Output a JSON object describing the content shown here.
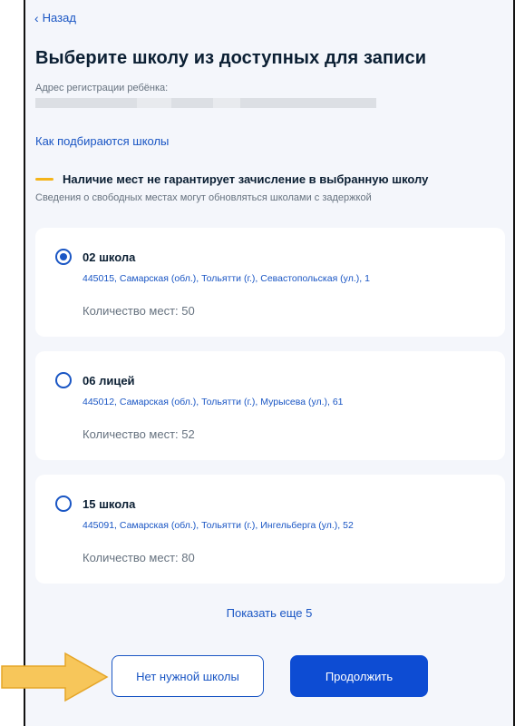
{
  "nav": {
    "back_label": "Назад"
  },
  "page": {
    "title": "Выберите школу из доступных для записи",
    "address_label": "Адрес регистрации ребёнка:",
    "how_link": "Как подбираются школы"
  },
  "notice": {
    "title": "Наличие мест не гарантирует зачисление в выбранную школу",
    "subtitle": "Сведения о свободных местах могут обновляться школами с задержкой",
    "accent_color": "#f4b41a"
  },
  "schools": [
    {
      "name": "02 школа",
      "address": "445015, Самарская (обл.), Тольятти (г.), Севастопольская (ул.), 1",
      "seats": "Количество мест: 50",
      "selected": true
    },
    {
      "name": "06 лицей",
      "address": "445012, Самарская (обл.), Тольятти (г.), Мурысева (ул.), 61",
      "seats": "Количество мест: 52",
      "selected": false
    },
    {
      "name": "15 школа",
      "address": "445091, Самарская (обл.), Тольятти (г.), Ингельберга (ул.), 52",
      "seats": "Количество мест: 80",
      "selected": false
    }
  ],
  "show_more": "Показать еще 5",
  "buttons": {
    "no_school": "Нет нужной школы",
    "continue": "Продолжить"
  },
  "colors": {
    "link": "#1a56c4",
    "primary": "#0d4cd3",
    "arrow": "#f7c65a"
  },
  "annotation_icon": "arrow-right-icon"
}
